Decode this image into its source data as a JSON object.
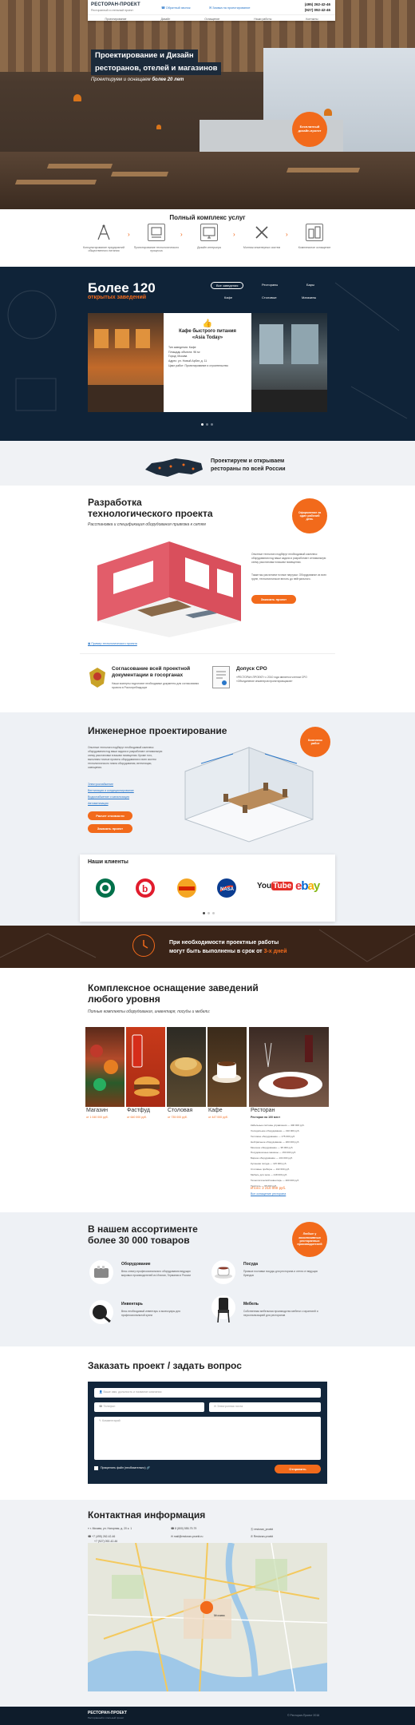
{
  "header": {
    "logo_title": "РЕСТОРАН-ПРОЕКТ",
    "logo_subtitle": "Ресторанный и отельный проект",
    "link_project": "Обратный звонок",
    "link_online": "Заявка на проектирование",
    "phone1": "(495) 262-42-46",
    "phone2": "(927) 092-42-46",
    "nav": [
      "Проектирование",
      "Дизайн",
      "Оснащение",
      "Наши работы",
      "Контакты"
    ]
  },
  "hero": {
    "title_line1": "Проектирование и Дизайн",
    "title_line2": "ресторанов, отелей и магазинов",
    "subtitle_pre": "Проектируем и оснащаем",
    "subtitle_bold": "более 20 лет",
    "badge": "Бесплатный дизайн-проект"
  },
  "services": {
    "title": "Полный комплекс услуг",
    "items": [
      {
        "label": "Консультирование предприятий общественного питания",
        "icon": "compass-icon"
      },
      {
        "label": "Проектирование технологического процесса",
        "icon": "blueprint-icon"
      },
      {
        "label": "Дизайн интерьера",
        "icon": "monitor-icon"
      },
      {
        "label": "Монтаж инженерных систем",
        "icon": "tools-icon"
      },
      {
        "label": "Комплексное оснащение",
        "icon": "equipment-icon"
      }
    ]
  },
  "works": {
    "count_title": "Более 120",
    "count_subtitle": "открытых заведений",
    "tabs": [
      "Все заведения",
      "Рестораны",
      "Бары",
      "Кафе",
      "Столовые",
      "Магазины"
    ],
    "card_title_line1": "Кафе быстрого питания",
    "card_title_line2": "«Asia Today»",
    "card_details": [
      "Тип заведения: Кафе",
      "Площадь объекта: 96 м²",
      "Город: Москва",
      "Адрес: ул. Новый Арбат, д. 11",
      "Цикл работ: Проектирование и строительство"
    ]
  },
  "russia": {
    "line1": "Проектируем и открываем",
    "line2": "рестораны по всей России"
  },
  "tech": {
    "title_line1": "Разработка",
    "title_line2": "технологического проекта",
    "subtitle": "Расстановка и спецификация оборудования привязка к сетям",
    "text1": "Опытные технологи подберут необходимый комплекс оборудования под ваши задачи и разработают оптимальную схему расстановки в вашем помещении.",
    "text2": "Также мы расчитаем точные нагрузки. Оборудование из всех групп, технологическое вплоть до нейтрального.",
    "button": "Заказать проект",
    "badge": "Оформление за один рабочий день",
    "link": "Пример технологического проекта"
  },
  "approval": {
    "title": "Согласование всей проектной документации в госорганах",
    "text": "Наши эксперты подготовят необходимые документы для согласования проекта в Роспотребнадзоре",
    "sro_title": "Допуск СРО",
    "sro_text": "«РЕСТОРАН-ПРОЕКТ» с 2010 года является членом СРО «Объединение инженеров проектировщиков»"
  },
  "engineering": {
    "title": "Инженерное проектирование",
    "text": "Опытные технологи подберут необходимый комплекс оборудования под ваши задачи и разработают оптимальную схему расстановки в вашем помещении. Кроме того, выполним точные проекты оборудования и всех систем технологического плана оборудования, вентиляции, освещения.",
    "links": [
      "Электроснабжение",
      "Вентиляция и кондиционирование",
      "Водоснабжение и канализация",
      "Автоматизация"
    ],
    "button1": "Расчет стоимости",
    "button2": "Заказать проект",
    "badge": "Комплекс работ"
  },
  "clients": {
    "title": "Наши клиенты",
    "logos": [
      "starbucks",
      "beats",
      "Burger King",
      "NASA",
      "YouTube",
      "ebay"
    ]
  },
  "promo": {
    "line1": "При необходимости проектные работы",
    "line2_pre": "могут быть выполнены в срок от ",
    "line2_accent": "3-х дней"
  },
  "equipment": {
    "title_line1": "Комплексное оснащение заведений",
    "title_line2": "любого уровня",
    "subtitle": "Полные комплекты оборудования, инвентаря, посуды и мебели:",
    "categories": [
      {
        "name": "Магазин",
        "price": "от 1 040 000 руб."
      },
      {
        "name": "Фастфуд",
        "price": "от 640 000 руб."
      },
      {
        "name": "Столовая",
        "price": "от 735 000 руб."
      },
      {
        "name": "Кафе",
        "price": "от 447 000 руб."
      },
      {
        "name": "Ресторан",
        "price": "Ресторан на 100 мест"
      }
    ],
    "restaurant_list": [
      "Кабельные системы управления — 400 000 руб.",
      "Холодильное оборудование — 310 000 руб.",
      "Тепловое оборудование — 175 000 руб.",
      "Нейтральное оборудование — 200 000 руб.",
      "Моечное оборудование — 95 000 руб.",
      "Посудомоечные машины — 150 000 руб.",
      "Барное оборудование — 104 000 руб.",
      "Кухонная посуда — 115 000 руб.",
      "Столовые приборы — 102 000 руб.",
      "Мебель для зала — 218 000 руб.",
      "Технологический инвентарь — 200 000 руб.",
      "Текстиль — 65 000 руб."
    ],
    "total": "Итого: 2 210 000 руб.",
    "total_link": "Все оснащение ресторана"
  },
  "assortment": {
    "title_line1": "В нашем ассортименте",
    "title_line2": "более 30 000 товаров",
    "badge": "Любые у эксклюзивных ресторанных производителей",
    "items": [
      {
        "name": "Оборудование",
        "desc": "Весь спектр профессионального оборудования ведущих мировых производителей из Италии, Германии и России",
        "icon": "toaster-icon"
      },
      {
        "name": "Посуда",
        "desc": "Прямые поставки посуды для ресторана и отеля от ведущих брендов",
        "icon": "cup-icon"
      },
      {
        "name": "Инвентарь",
        "desc": "Весь необходимый инвентарь и аксессуары для профессиональной кухни",
        "icon": "pan-icon"
      },
      {
        "name": "Мебель",
        "desc": "Собственная мебельная производство мебели с гарантией и персонализацией для ресторанов",
        "icon": "chair-icon"
      }
    ]
  },
  "order": {
    "title": "Заказать проект / задать вопрос",
    "name_placeholder": "Ваше имя, должность и название компании",
    "phone_placeholder": "Телефон",
    "email_placeholder": "Электронная почта",
    "comment_placeholder": "Комментарий",
    "attach": "Прикрепить файл (необязательно)",
    "submit": "Отправить"
  },
  "contacts": {
    "title": "Контактная информация",
    "address": "г. Москва, ул. Нагорная, д. 20 к. 1",
    "phone": "8 (800) 555-79-79",
    "email": "mail@restoran-proekt.ru",
    "hours1": "+7 (495) 262-42-46",
    "hours2": "+7 (927) 092-42-46",
    "skype": "restoran_proekt",
    "whatsapp": "Restoran-proekt",
    "vk": "Подписаться в ВКонтакте",
    "map_city": "Москва"
  },
  "footer": {
    "logo": "РЕСТОРАН-ПРОЕКТ",
    "logo_sub": "Ресторанный и отельный проект",
    "copyright": "© Ресторан-Проект 2016"
  },
  "colors": {
    "accent": "#f26a1b",
    "dark": "#0f2338",
    "link": "#2a77c9"
  }
}
